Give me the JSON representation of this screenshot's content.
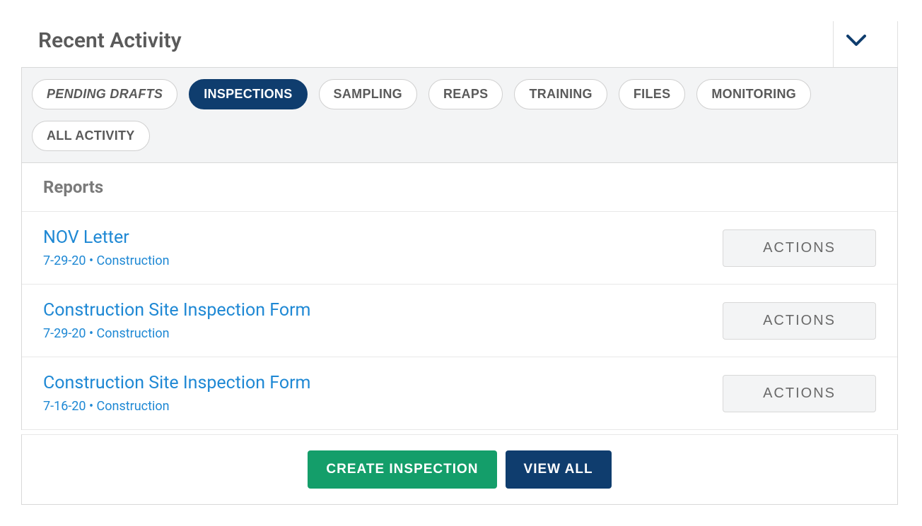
{
  "header": {
    "title": "Recent Activity"
  },
  "tabs": [
    {
      "label": "PENDING DRAFTS",
      "italic": true,
      "active": false
    },
    {
      "label": "INSPECTIONS",
      "italic": false,
      "active": true
    },
    {
      "label": "SAMPLING",
      "italic": false,
      "active": false
    },
    {
      "label": "REAPS",
      "italic": false,
      "active": false
    },
    {
      "label": "TRAINING",
      "italic": false,
      "active": false
    },
    {
      "label": "FILES",
      "italic": false,
      "active": false
    },
    {
      "label": "MONITORING",
      "italic": false,
      "active": false
    },
    {
      "label": "ALL ACTIVITY",
      "italic": false,
      "active": false
    }
  ],
  "section": {
    "heading": "Reports"
  },
  "reports": [
    {
      "title": "NOV Letter",
      "meta": "7-29-20 • Construction",
      "action": "ACTIONS"
    },
    {
      "title": "Construction Site Inspection Form",
      "meta": "7-29-20 • Construction",
      "action": "ACTIONS"
    },
    {
      "title": "Construction Site Inspection Form",
      "meta": "7-16-20 • Construction",
      "action": "ACTIONS"
    }
  ],
  "footer": {
    "create": "CREATE INSPECTION",
    "viewAll": "VIEW ALL"
  }
}
